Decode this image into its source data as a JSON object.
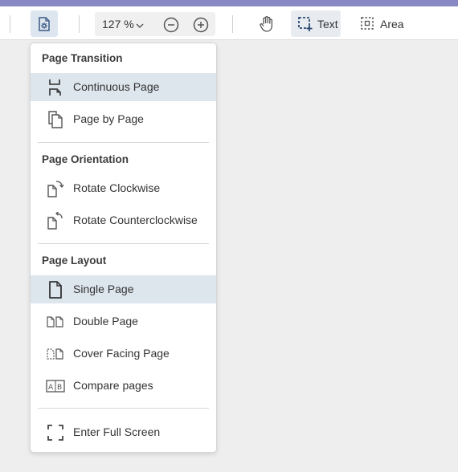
{
  "toolbar": {
    "zoom_value": "127 %",
    "text_label": "Text",
    "area_label": "Area",
    "accent_color": "#8788c4"
  },
  "menu": {
    "sections": [
      {
        "header": "Page Transition",
        "items": [
          {
            "label": "Continuous Page",
            "icon": "continuous-page-icon",
            "selected": true
          },
          {
            "label": "Page by Page",
            "icon": "page-by-page-icon",
            "selected": false
          }
        ]
      },
      {
        "header": "Page Orientation",
        "items": [
          {
            "label": "Rotate Clockwise",
            "icon": "rotate-clockwise-icon",
            "selected": false
          },
          {
            "label": "Rotate Counterclockwise",
            "icon": "rotate-counterclockwise-icon",
            "selected": false
          }
        ]
      },
      {
        "header": "Page Layout",
        "items": [
          {
            "label": "Single Page",
            "icon": "single-page-icon",
            "selected": true
          },
          {
            "label": "Double Page",
            "icon": "double-page-icon",
            "selected": false
          },
          {
            "label": "Cover Facing Page",
            "icon": "cover-facing-page-icon",
            "selected": false
          },
          {
            "label": "Compare pages",
            "icon": "compare-pages-icon",
            "selected": false
          }
        ]
      }
    ],
    "fullscreen": {
      "label": "Enter Full Screen",
      "icon": "fullscreen-icon"
    }
  }
}
